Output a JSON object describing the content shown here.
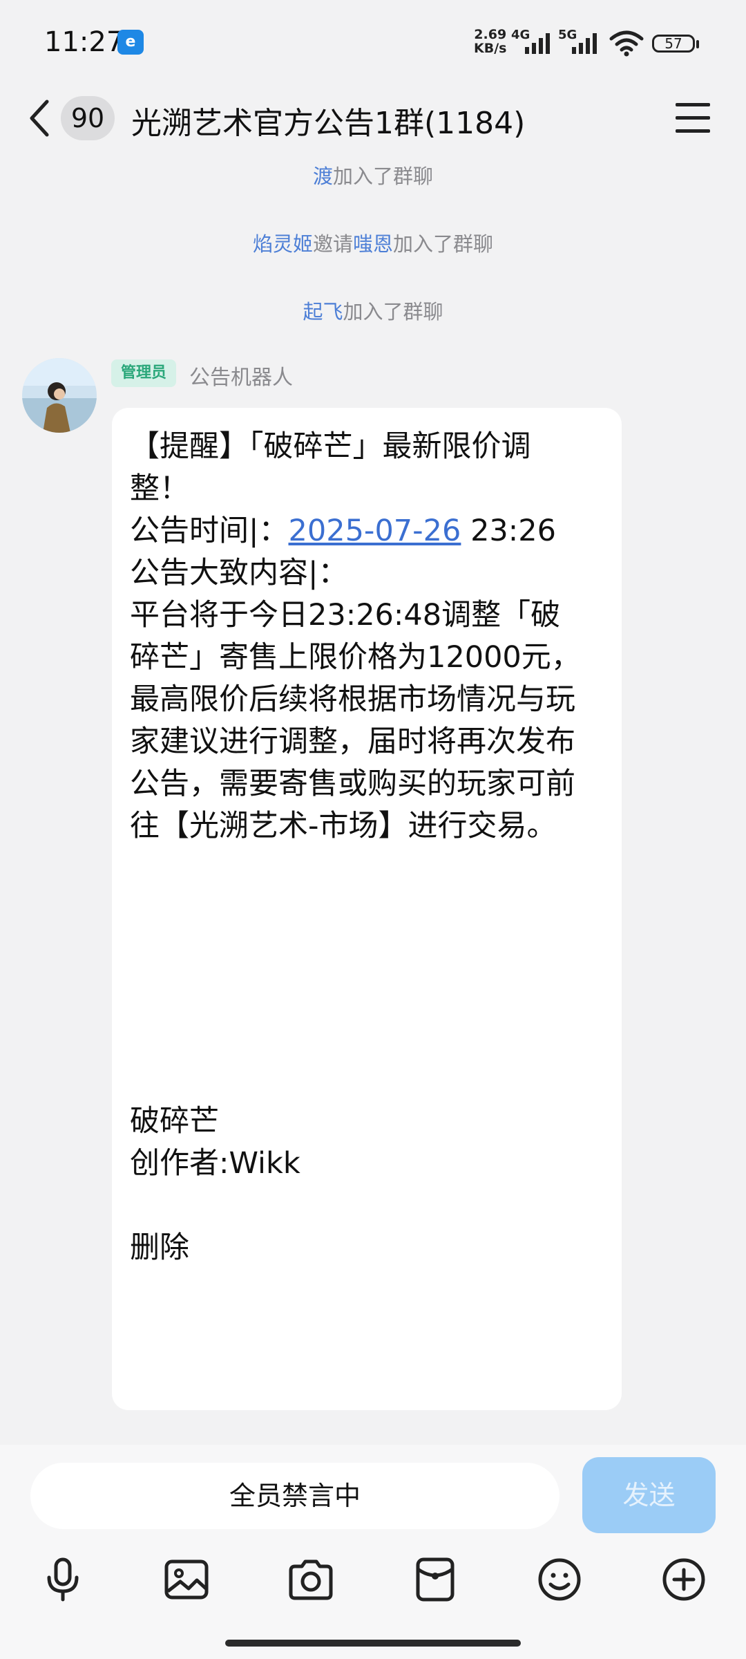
{
  "status_bar": {
    "time": "11:27",
    "app_badge": "e",
    "net_speed_value": "2.69",
    "net_speed_unit": "KB/s",
    "signal1_label": "4G",
    "signal2_label": "5G",
    "battery": "57"
  },
  "header": {
    "unread_count": "90",
    "title": "光溯艺术官方公告1群(1184)"
  },
  "notices": [
    {
      "name": "渡",
      "text": "加入了群聊"
    },
    {
      "name": "焰灵姬",
      "mid": "邀请",
      "name2": "嗤恩",
      "text": "加入了群聊"
    },
    {
      "name": "起飞",
      "text": "加入了群聊"
    }
  ],
  "message": {
    "role_tag": "管理员",
    "sender": "公告机器人",
    "line1": "【提醒】「破碎芒」最新限价调",
    "line2": "整！",
    "time_label": "公告时间|：",
    "date": "2025-07-26",
    "time": " 23:26",
    "content_label": "公告大致内容|：",
    "body": [
      "平台将于今日23:26:48调整「破",
      "碎芒」寄售上限价格为12000元，",
      "最高限价后续将根据市场情况与玩",
      "家建议进行调整，届时将再次发布",
      "公告，需要寄售或购买的玩家可前",
      "往【光溯艺术-市场】进行交易。"
    ],
    "footer_name": "破碎芒",
    "author": "创作者:Wikk",
    "delete": "删除"
  },
  "input": {
    "muted_text": "全员禁言中",
    "send_label": "发送"
  },
  "toolbar_icons": [
    "microphone-icon",
    "image-icon",
    "camera-icon",
    "red-packet-icon",
    "emoji-icon",
    "plus-icon"
  ],
  "colors": {
    "background": "#f2f2f3",
    "link": "#3b6fd1",
    "notice_name": "#4d7fd6",
    "admin_tag_bg": "#d6f1e8",
    "admin_tag_text": "#2aa77a",
    "send_button": "#9bccf6"
  }
}
